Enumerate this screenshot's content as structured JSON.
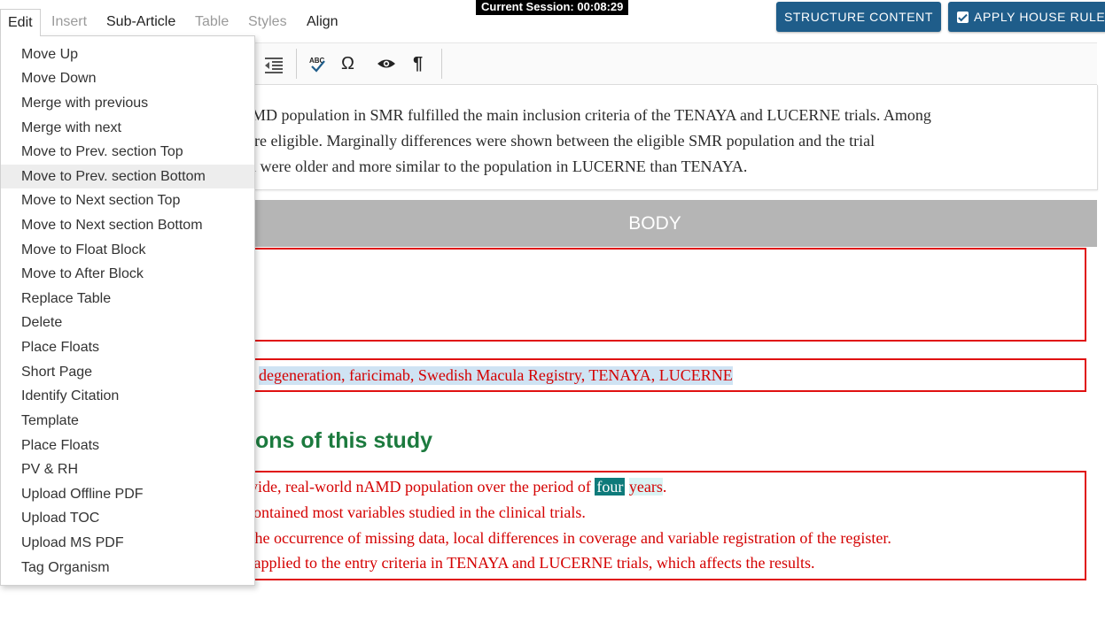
{
  "menubar": {
    "edit": "Edit",
    "insert": "Insert",
    "subarticle": "Sub-Article",
    "table": "Table",
    "styles": "Styles",
    "align": "Align"
  },
  "session": "Current Session: 00:08:29",
  "buttons": {
    "structure": "STRUCTURE CONTENT",
    "house_rules": "APPLY HOUSE RULES"
  },
  "toolbar": {
    "outdent": "outdent-icon",
    "spellcheck": "spellcheck-icon",
    "spell_label": "ABC",
    "omega": "Ω",
    "pilcrow": "¶"
  },
  "paragraph": {
    "line1": "MD population in SMR fulfilled the main inclusion criteria of the TENAYA and LUCERNE trials. Among",
    "line2": "were eligible. Marginally differences were shown between the eligible SMR population and the trial",
    "line3": "n were older and more similar to the population in LUCERNE than TENAYA."
  },
  "body_band": "BODY",
  "keywords": "degeneration, faricimab, Swedish Macula Registry, TENAYA, LUCERNE",
  "heading": "ons of this study",
  "limitations": {
    "l1_pre": "on-wide, real-world nAMD population over the period of ",
    "l1_four": "four",
    "l1_years": "years",
    "l1_end": ".",
    "l2": "contained most variables studied in the clinical trials.",
    "l3": "ude the occurrence of missing data, local differences in coverage and variable registration of the register.",
    "l4": "was applied to the entry criteria in TENAYA and LUCERNE trials, which affects the results."
  },
  "edit_menu": [
    "Move Up",
    "Move Down",
    "Merge with previous",
    "Merge with next",
    "Move to Prev. section Top",
    "Move to Prev. section Bottom",
    "Move to Next section Top",
    "Move to Next section Bottom",
    "Move to Float Block",
    "Move to After Block",
    "Replace Table",
    "Delete",
    "Place Floats",
    "Short Page",
    "Identify Citation",
    "Template",
    "Place Floats",
    "PV & RH",
    "Upload Offline PDF",
    "Upload TOC",
    "Upload MS PDF",
    "Tag Organism"
  ],
  "colors": {
    "accent_button": "#1f5d8a",
    "error_border": "#e01010",
    "heading_green": "#1c7a3e",
    "highlight_teal": "#0e7a7a"
  }
}
